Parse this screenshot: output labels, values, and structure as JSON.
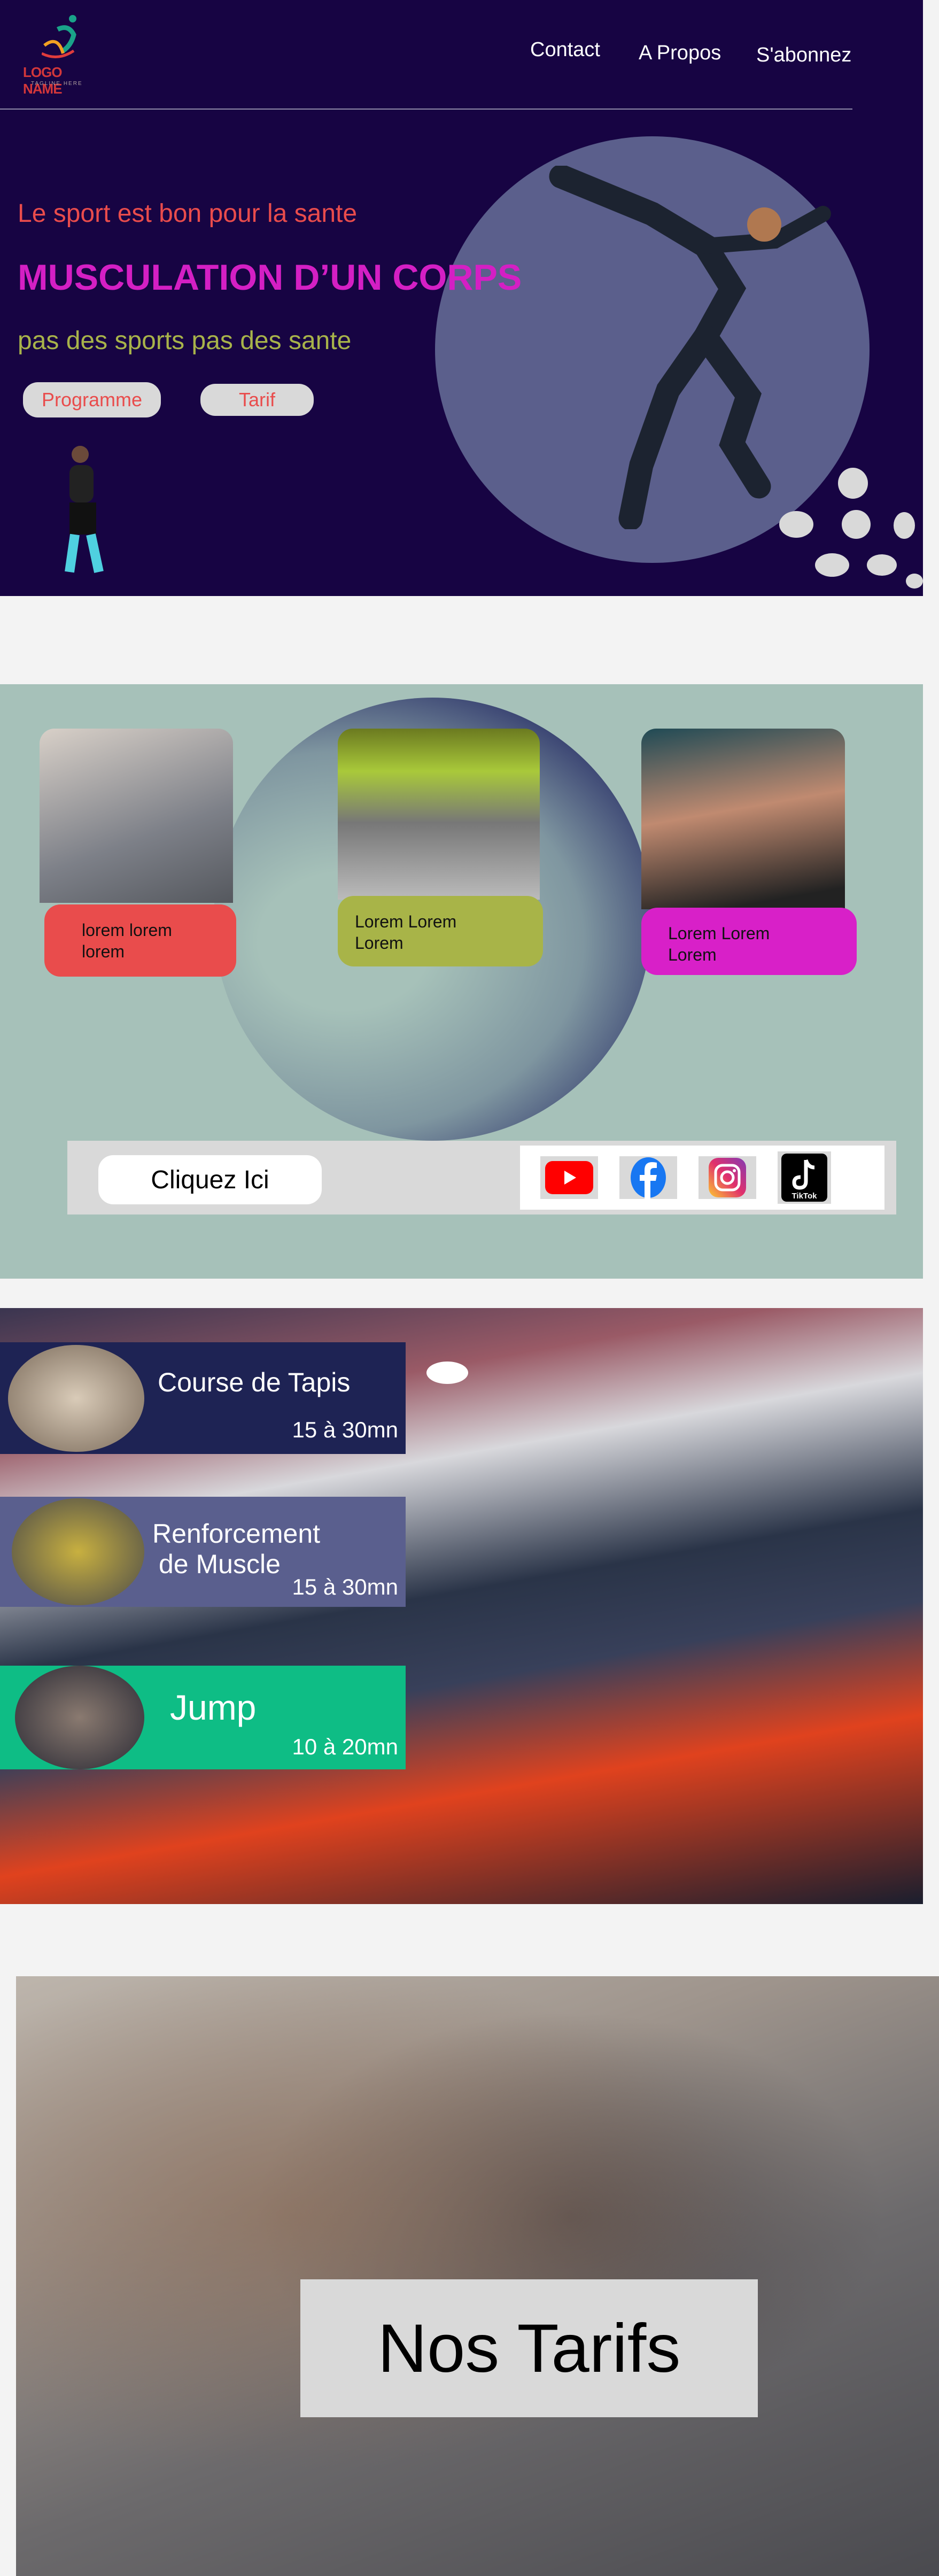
{
  "header": {
    "logo": {
      "name": "LOGO NAME",
      "tagline": "TAGLINE HERE"
    },
    "nav": [
      {
        "label": "Contact"
      },
      {
        "label": "A Propos"
      },
      {
        "label": "S'abonnez"
      }
    ]
  },
  "hero": {
    "tagline": "Le sport est bon pour la sante",
    "title": "MUSCULATION D’UN CORPS",
    "subtitle": "pas des sports pas des sante",
    "buttons": [
      {
        "label": "Programme"
      },
      {
        "label": "Tarif"
      }
    ],
    "colors": {
      "bg": "#170443",
      "tagline": "#e94c4c",
      "title": "#d41fc4",
      "subtitle": "#a8b34a"
    }
  },
  "cards": [
    {
      "line1": "lorem lorem",
      "line2": "lorem",
      "color": "#e94c4c"
    },
    {
      "line1": "Lorem Lorem",
      "line2": "Lorem",
      "color": "#a8b448"
    },
    {
      "line1": "Lorem Lorem",
      "line2": "Lorem",
      "color": "#d820c8"
    }
  ],
  "cta": {
    "label": "Cliquez Ici"
  },
  "social": [
    {
      "icon": "youtube-icon"
    },
    {
      "icon": "facebook-icon"
    },
    {
      "icon": "instagram-icon"
    },
    {
      "icon": "tiktok-icon",
      "label": "TikTok"
    }
  ],
  "programs": [
    {
      "title": "Course de Tapis",
      "time": "15 à 30mn",
      "color": "#1e2354"
    },
    {
      "title": "Renforcement",
      "title2": "de Muscle",
      "time": "15 à 30mn",
      "color": "#5a5f8e"
    },
    {
      "title": "Jump",
      "time": "10 à 20mn",
      "color": "#0ebd85"
    }
  ],
  "tarifs": {
    "title": "Nos Tarifs"
  }
}
